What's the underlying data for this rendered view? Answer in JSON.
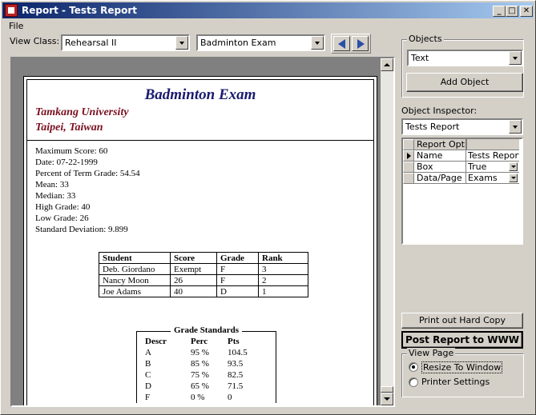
{
  "window": {
    "title": "Report - Tests Report",
    "buttons": {
      "minimize": "_",
      "maximize": "□",
      "close": "✕"
    }
  },
  "menu": {
    "file": "File"
  },
  "view_class": {
    "label": "View Class:",
    "class_value": "Rehearsal II",
    "exam_value": "Badminton Exam"
  },
  "report": {
    "title": "Badminton Exam",
    "university": "Tamkang University",
    "location": "Taipei, Taiwan",
    "stats": [
      "Maximum Score: 60",
      "Date:  07-22-1999",
      "Percent of Term Grade: 54.54",
      "Mean: 33",
      "Median: 33",
      "High Grade: 40",
      "Low Grade: 26",
      "Standard Deviation: 9.899"
    ],
    "scores_table": {
      "headers": [
        "Student",
        "Score",
        "Grade",
        "Rank"
      ],
      "rows": [
        [
          "Deb. Giordano",
          "Exempt",
          "F",
          "3"
        ],
        [
          "Nancy Moon",
          "26",
          "F",
          "2"
        ],
        [
          "Joe Adams",
          "40",
          "D",
          "1"
        ]
      ]
    },
    "grade_standards": {
      "title": "Grade Standards",
      "headers": [
        "Descr",
        "Perc",
        "Pts"
      ],
      "rows": [
        [
          "A",
          "95 %",
          "104.5"
        ],
        [
          "B",
          "85 %",
          "93.5"
        ],
        [
          "C",
          "75 %",
          "82.5"
        ],
        [
          "D",
          "65 %",
          "71.5"
        ],
        [
          "F",
          "0 %",
          "0"
        ]
      ]
    }
  },
  "objects_panel": {
    "label": "Objects",
    "selected": "Text",
    "add_button": "Add Object"
  },
  "inspector": {
    "label": "Object Inspector:",
    "selected": "Tests Report",
    "header": "Report Options",
    "rows": [
      {
        "name": "Name",
        "value": "Tests Report"
      },
      {
        "name": "Box",
        "value": "True"
      },
      {
        "name": "Data/Page",
        "value": "Exams"
      }
    ]
  },
  "actions": {
    "print_button": "Print out Hard Copy",
    "post_button": "Post Report to WWW"
  },
  "view_page": {
    "label": "View Page",
    "options": [
      "Resize To Window",
      "Printer Settings"
    ],
    "selected_index": 0
  }
}
